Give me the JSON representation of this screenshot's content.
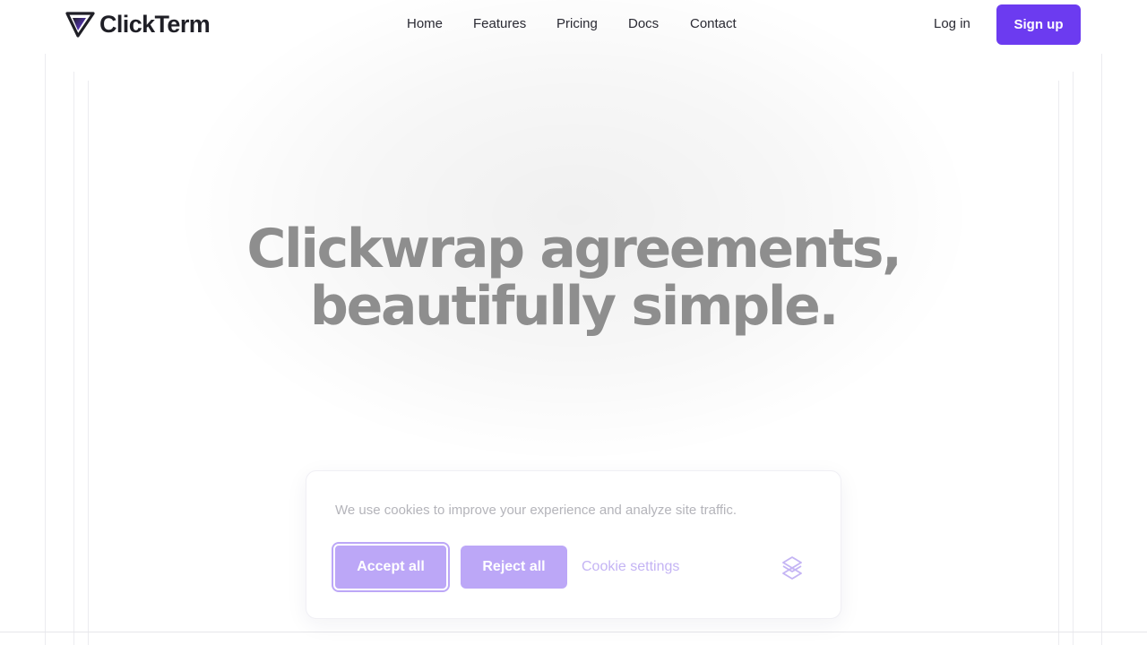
{
  "brand": {
    "name": "ClickTerm",
    "logo_icon": "arrow-cursor-logo-icon",
    "accent": "#6c3bf0"
  },
  "nav": {
    "items": [
      {
        "label": "Home"
      },
      {
        "label": "Features"
      },
      {
        "label": "Pricing"
      },
      {
        "label": "Docs"
      },
      {
        "label": "Contact"
      }
    ]
  },
  "auth": {
    "login_label": "Log in",
    "signup_label": "Sign up"
  },
  "hero": {
    "line1": "Clickwrap agreements,",
    "line2": "beautifully simple."
  },
  "cookie_banner": {
    "message": "We use cookies to improve your experience and analyze site traffic.",
    "accept_label": "Accept all",
    "reject_label": "Reject all",
    "settings_label": "Cookie settings",
    "mark_icon": "cookie-consent-logo-icon",
    "button_color": "#bca7f7"
  }
}
